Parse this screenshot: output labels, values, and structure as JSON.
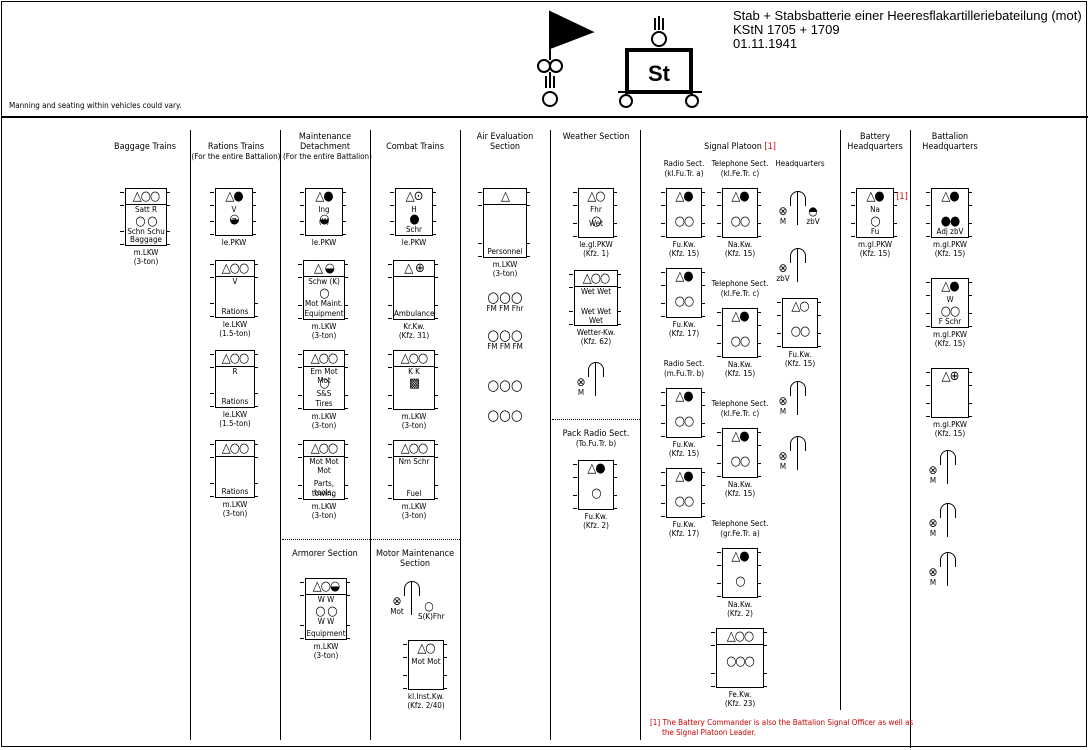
{
  "header": {
    "title": "Stab + Stabsbatterie einer Heeresflakartilleriebateilung (mot)",
    "kstn": "KStN 1705 + 1709",
    "date": "01.11.1941",
    "note": "Manning and seating within vehicles could vary.",
    "emblem_label": "St"
  },
  "sections": [
    {
      "title": "Baggage Trains"
    },
    {
      "title": "Rations Trains",
      "sub": "(For the entire Battalion)"
    },
    {
      "title": "Maintenance Detachment",
      "sub": "(For the entire Battalion)"
    },
    {
      "title": "Combat Trains"
    },
    {
      "title": "Air Evaluation Section"
    },
    {
      "title": "Weather Section"
    },
    {
      "title": "Signal Platoon",
      "ref": "[1]"
    },
    {
      "title": "Battery Headquarters"
    },
    {
      "title": "Battalion Headquarters"
    },
    {
      "title": "Armorer Section"
    },
    {
      "title": "Motor Maintenance Section"
    },
    {
      "title": "Pack Radio Sect.",
      "sub": "(To.Fu.Tr. b)"
    }
  ],
  "subsections": [
    {
      "title": "Radio Sect.",
      "sub": "(kl.Fu.Tr. a)"
    },
    {
      "title": "Telephone Sect.",
      "sub": "(kl.Fe.Tr. c)"
    },
    {
      "title": "Headquarters"
    },
    {
      "title": "Telephone Sect.",
      "sub": "(kl.Fe.Tr. c)"
    },
    {
      "title": "Radio Sect.",
      "sub": "(m.Fu.Tr. b)"
    },
    {
      "title": "Telephone Sect.",
      "sub": "(kl.Fe.Tr. c)"
    },
    {
      "title": "Telephone Sect.",
      "sub": "(gr.Fe.Tr. a)"
    }
  ],
  "vehicles": [
    {
      "row1": "△○○",
      "div": true,
      "l1": "Satt R",
      "row2": "○  ○",
      "l2": "Schn Schu",
      "bottom": "Baggage",
      "cap": "m.LKW",
      "cap2": "(3-ton)"
    },
    {
      "row1": "△●",
      "l1": "V",
      "row2": "◒",
      "l2": "Z",
      "cap": "le.PKW"
    },
    {
      "row1": "△○○",
      "div": true,
      "l1": "V",
      "bottom": "Rations",
      "cap": "le.LKW",
      "cap2": "(1.5-ton)"
    },
    {
      "row1": "△○○",
      "div": true,
      "l1": "R",
      "bottom": "Rations",
      "cap": "le.LKW",
      "cap2": "(1.5-ton)"
    },
    {
      "row1": "△○○",
      "div": true,
      "bottom": "Rations",
      "cap": "m.LKW",
      "cap2": "(3-ton)"
    },
    {
      "row1": "△●",
      "l1": "Ing",
      "row2": "◒",
      "l2": "(K)",
      "cap": "le.PKW"
    },
    {
      "row1": "△  ◒",
      "div": true,
      "l1": "Schw (K)",
      "row2": "○",
      "l2": "Mot Maint.",
      "bottom": "Equipment",
      "cap": "m.LKW",
      "cap2": "(3-ton)"
    },
    {
      "row1": "△○○",
      "div": true,
      "l1": "Em Mot Mot",
      "row2": "○",
      "l2": "S&S",
      "bottom": "Tires",
      "cap": "m.LKW",
      "cap2": "(3-ton)"
    },
    {
      "row1": "△○○",
      "div": true,
      "l1": "Mot Mot Mot",
      "l2": "Parts, tools,",
      "bottom": "towing",
      "cap": "m.LKW",
      "cap2": "(3-ton)"
    },
    {
      "row1": "△⊙",
      "l1": "H",
      "row2": "●",
      "bottom": "Schr",
      "cap": "le.PKW"
    },
    {
      "row1": "△  ⊕",
      "div": true,
      "bottom": "Ambulance",
      "cap": "Kr.Kw.",
      "cap2": "(Kfz. 31)"
    },
    {
      "row1": "△○○",
      "div": true,
      "l1": "K  K",
      "row2": "▩",
      "cap": "m.LKW",
      "cap2": "(3-ton)"
    },
    {
      "row1": "△○○",
      "div": true,
      "l1": "Nm Schr",
      "bottom": "Fuel",
      "cap": "m.LKW",
      "cap2": "(3-ton)"
    },
    {
      "row1": "△",
      "div": true,
      "bottom": "Personnel",
      "cap": "m.LKW",
      "cap2": "(3-ton)"
    },
    {
      "row1": "△○",
      "l1": "Fhr",
      "row2": "○",
      "l2": "Wet",
      "cap": "le.gl.PKW",
      "cap2": "(Kfz. 1)"
    },
    {
      "row1": "△○○",
      "div": true,
      "l1": "Wet Wet",
      "row2": "",
      "l2": "Wet Wet Wet",
      "cap": "Wetter-Kw.",
      "cap2": "(Kfz. 62)"
    },
    {
      "row1": "△●",
      "row2": "○",
      "cap": "Fu.Kw.",
      "cap2": "(Kfz. 2)"
    },
    {
      "row1": "△○◒",
      "div": true,
      "l1": "W  W",
      "row2": "○  ○",
      "l2": "W  W",
      "bottom": "Equipment",
      "cap": "m.LKW",
      "cap2": "(3-ton)"
    },
    {
      "row1": "△○",
      "l1": "Mot Mot",
      "cap": "kl.Inst.Kw.",
      "cap2": "(Kfz. 2/40)"
    },
    {
      "row1": "△●",
      "row2": "○○",
      "cap": "Fu.Kw.",
      "cap2": "(Kfz. 15)"
    },
    {
      "row1": "△●",
      "row2": "○○",
      "cap": "Fu.Kw.",
      "cap2": "(Kfz. 17)"
    },
    {
      "row1": "△●",
      "row2": "○○",
      "cap": "Fu.Kw.",
      "cap2": "(Kfz. 15)"
    },
    {
      "row1": "△●",
      "row2": "○○",
      "cap": "Fu.Kw.",
      "cap2": "(Kfz. 17)"
    },
    {
      "row1": "△●",
      "row2": "○○",
      "cap": "Na.Kw.",
      "cap2": "(Kfz. 15)"
    },
    {
      "row1": "△●",
      "row2": "○○",
      "cap": "Na.Kw.",
      "cap2": "(Kfz. 15)"
    },
    {
      "row1": "△●",
      "row2": "○○",
      "cap": "Na.Kw.",
      "cap2": "(Kfz. 15)"
    },
    {
      "row1": "△●",
      "row2": "○",
      "cap": "Na.Kw.",
      "cap2": "(Kfz. 2)"
    },
    {
      "row1": "△○○",
      "div": true,
      "row2": "○○○",
      "cap": "Fe.Kw.",
      "cap2": "(Kfz. 23)"
    },
    {
      "row1": "△○",
      "row2": "○○",
      "cap": "Fu.Kw.",
      "cap2": "(Kfz. 15)"
    },
    {
      "row1": "△●",
      "l1": "Na",
      "row2": "○",
      "bottom": "Fu",
      "cap": "m.gl.PKW",
      "cap2": "(Kfz. 15)"
    },
    {
      "row1": "△●",
      "row2": "●●",
      "bottom": "Adj zbV",
      "cap": "m.gl.PKW",
      "cap2": "(Kfz. 15)"
    },
    {
      "row1": "△●",
      "l1": "W",
      "row2": "○○",
      "bottom": "F Schr",
      "cap": "m.gl.PKW",
      "cap2": "(Kfz. 15)"
    },
    {
      "row1": "△⊕",
      "cap": "m.gl.PKW",
      "cap2": "(Kfz. 15)"
    }
  ],
  "persons": [
    {
      "glyph": "⊗",
      "label": "M"
    },
    {
      "glyph": "◓",
      "label": "zbV"
    },
    {
      "glyph": "⊗",
      "label": "zbV"
    },
    {
      "glyph": "⊗",
      "label": "M"
    },
    {
      "glyph": "⊗",
      "label": "M"
    },
    {
      "glyph": "⊗",
      "label": "M"
    },
    {
      "glyph": "⊗",
      "label": "M"
    },
    {
      "glyph": "⊗",
      "label": "M"
    },
    {
      "glyph": "⊗",
      "label": "M"
    },
    {
      "glyph": "⊗",
      "label": "Mot"
    },
    {
      "glyph": "○",
      "label": "S(K)Fhr"
    }
  ],
  "air_personnel": [
    {
      "glyph": "○○○",
      "label": "FM FM Fhr"
    },
    {
      "glyph": "○○○",
      "label": "FM FM FM"
    },
    {
      "glyph": "○○○",
      "label": ""
    },
    {
      "glyph": "○○○",
      "label": ""
    }
  ],
  "battery_ref": "[1]",
  "footnote": {
    "ref": "[1]",
    "line1": "The Battery Commander is also the Battalion Signal Officer as well as",
    "line2": "the Signal Platoon Leader."
  },
  "colors": {
    "footnote": "#cc0000",
    "lines": "#000000"
  }
}
